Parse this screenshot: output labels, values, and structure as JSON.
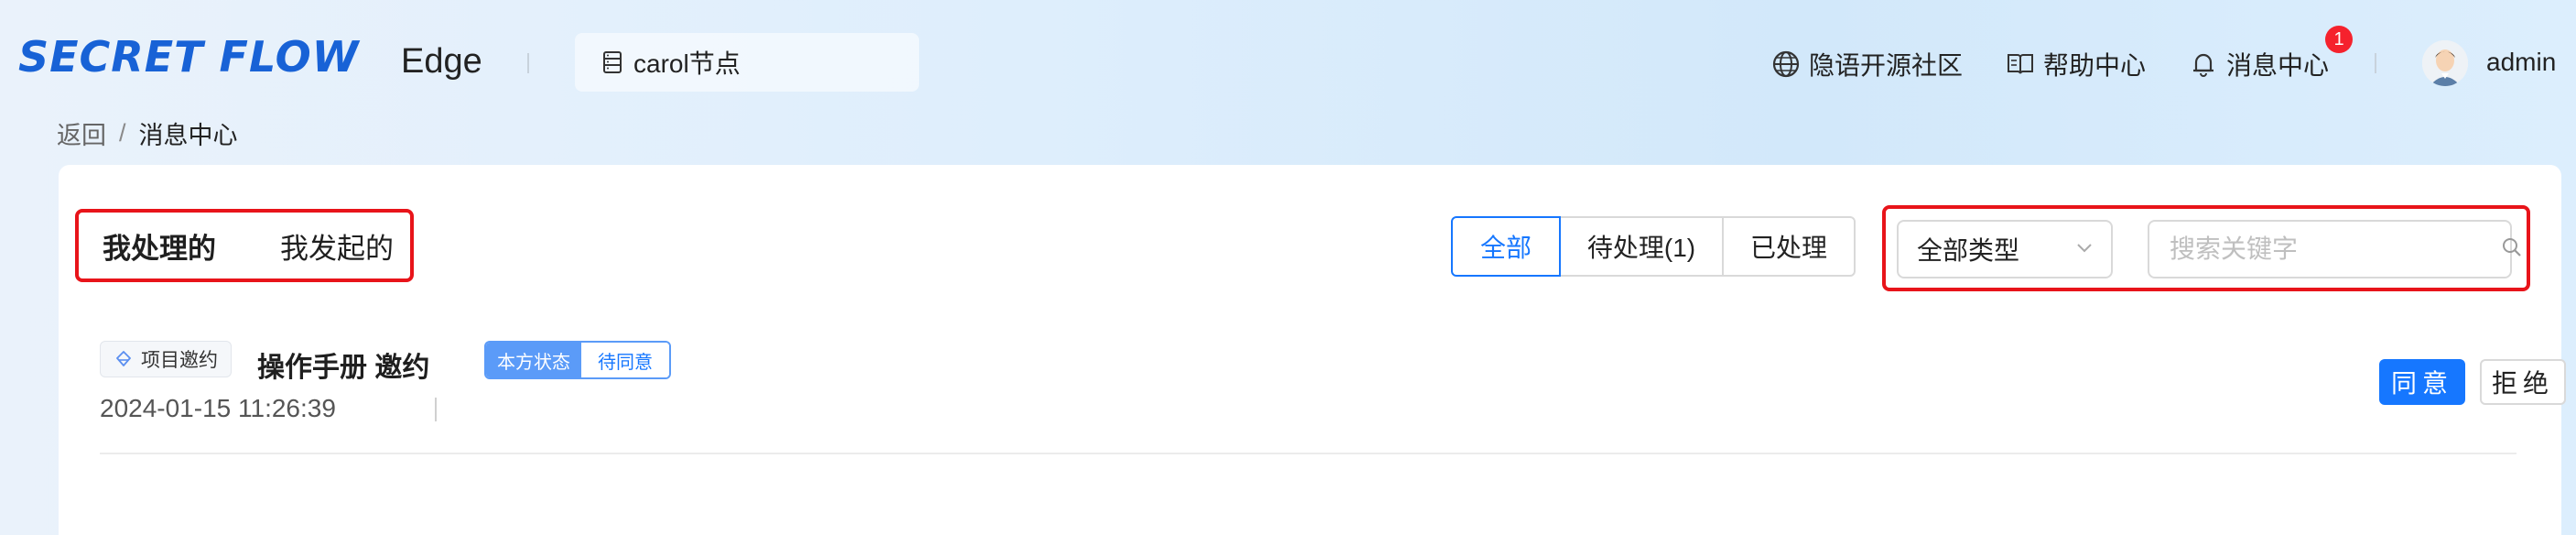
{
  "header": {
    "logo_text": "SECRET FLOW",
    "app_name": "Edge",
    "node_label": "carol节点",
    "nav": {
      "community": "隐语开源社区",
      "help": "帮助中心",
      "messages": "消息中心",
      "messages_badge": "1"
    },
    "user": "admin"
  },
  "breadcrumb": {
    "back": "返回",
    "separator": "/",
    "current": "消息中心"
  },
  "tabs": {
    "handled_by_me": "我处理的",
    "initiated_by_me": "我发起的"
  },
  "status_filter": {
    "all": "全部",
    "pending": "待处理(1)",
    "processed": "已处理"
  },
  "type_select": {
    "value": "全部类型"
  },
  "search": {
    "placeholder": "搜索关键字"
  },
  "messages": [
    {
      "type_tag": "项目邀约",
      "title": "操作手册  邀约",
      "status_label": "本方状态",
      "status_value": "待同意",
      "time": "2024-01-15 11:26:39",
      "agree_label": "同意",
      "reject_label": "拒绝"
    }
  ],
  "colors": {
    "primary": "#1677ff",
    "highlight_box": "#e8141a",
    "logo": "#1862d6",
    "badge": "#f5222d"
  }
}
